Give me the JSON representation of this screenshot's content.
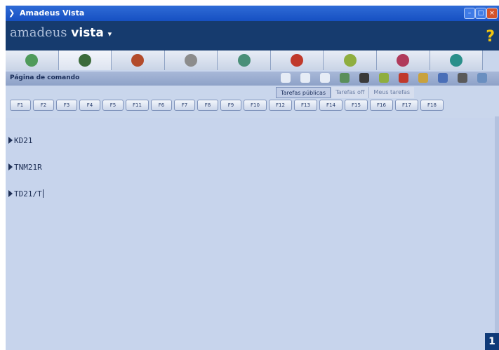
{
  "window": {
    "title": "Amadeus Vista"
  },
  "header": {
    "brand_light": "amadeus",
    "brand_bold": "vista",
    "help_label": "?"
  },
  "tabs": [
    {
      "icon": "globe-money-icon",
      "color": "#4f9a5a"
    },
    {
      "icon": "shield-icon",
      "color": "#3c6b3a"
    },
    {
      "icon": "euro-coins-icon",
      "color": "#b34b2a"
    },
    {
      "icon": "sun-icon",
      "color": "#8c8c8c"
    },
    {
      "icon": "car-icon",
      "color": "#4a8f78"
    },
    {
      "icon": "person-icon",
      "color": "#c0392b"
    },
    {
      "icon": "map-icon",
      "color": "#8fae3f"
    },
    {
      "icon": "alarm-clock-icon",
      "color": "#b03a5b"
    },
    {
      "icon": "earth-icon",
      "color": "#2a8f8a"
    }
  ],
  "command": {
    "label": "Página de comando",
    "toolbar_icons": [
      "circle-icon",
      "circle-icon",
      "circle-icon",
      "pencil-icon",
      "plane-icon",
      "document-icon",
      "search-icon",
      "copy-icon",
      "paste-icon",
      "print-icon",
      "printer-icon"
    ],
    "links": [
      "Tarefas públicas",
      "Tarefas off",
      "Meus tarefas"
    ]
  },
  "fkeys": [
    "F1",
    "F2",
    "F3",
    "F4",
    "F5",
    "F11",
    "F6",
    "F7",
    "F8",
    "F9",
    "F10",
    "F12",
    "F13",
    "F14",
    "F15",
    "F16",
    "F17",
    "F18"
  ],
  "editor": {
    "lines": [
      "KD21",
      "TNM21R",
      "TD21/T"
    ]
  },
  "badge": "1"
}
